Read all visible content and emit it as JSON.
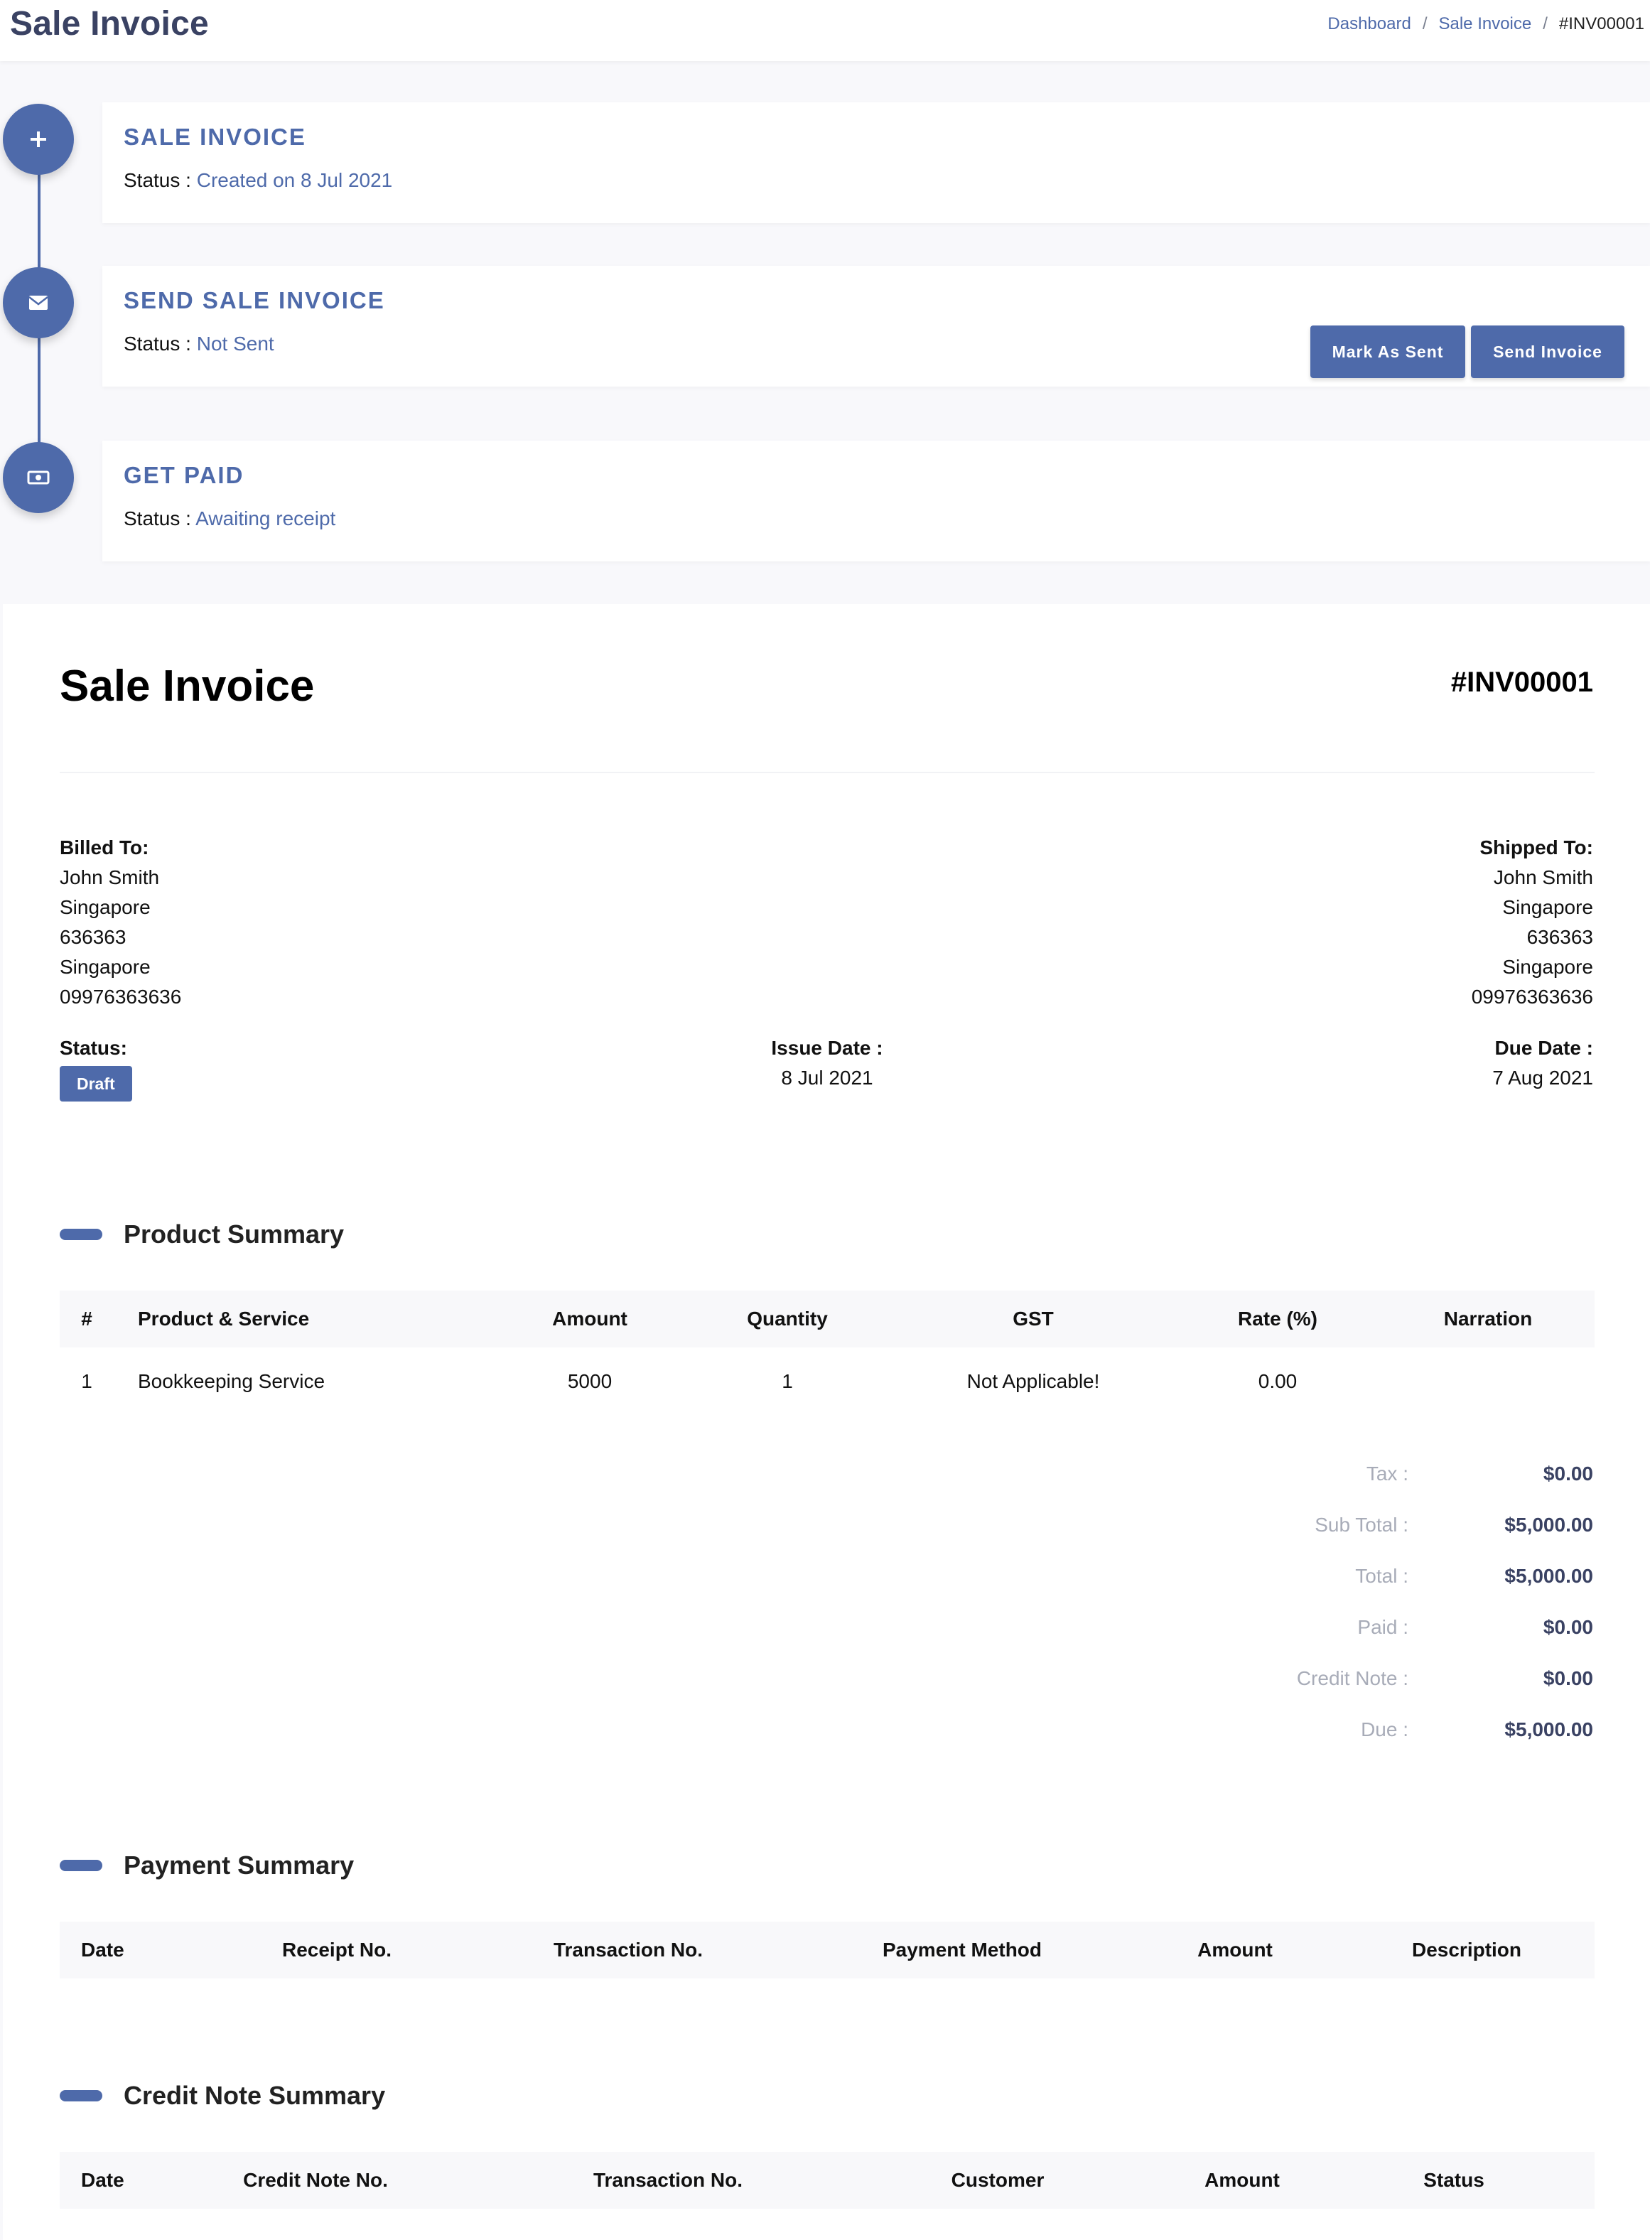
{
  "header": {
    "title": "Sale Invoice",
    "breadcrumb": [
      "Dashboard",
      "Sale Invoice",
      "#INV00001"
    ],
    "separator": "/"
  },
  "timeline": {
    "status_label": "Status :",
    "steps": [
      {
        "icon": "plus-icon",
        "title": "SALE INVOICE",
        "status": "Created on 8 Jul 2021"
      },
      {
        "icon": "envelope-icon",
        "title": "SEND SALE INVOICE",
        "status": "Not Sent"
      },
      {
        "icon": "money-icon",
        "title": "GET PAID",
        "status": "Awaiting receipt"
      }
    ],
    "buttons": {
      "mark_as_sent": "Mark As Sent",
      "send_invoice": "Send Invoice"
    }
  },
  "invoice": {
    "title": "Sale Invoice",
    "number": "#INV00001",
    "billed_to": {
      "label": "Billed To:",
      "lines": [
        "John Smith",
        "Singapore",
        "636363",
        "Singapore",
        "09976363636"
      ]
    },
    "shipped_to": {
      "label": "Shipped To:",
      "lines": [
        "John Smith",
        "Singapore",
        "636363",
        "Singapore",
        "09976363636"
      ]
    },
    "status": {
      "label": "Status:",
      "value": "Draft"
    },
    "issue_date": {
      "label": "Issue Date :",
      "value": "8 Jul 2021"
    },
    "due_date": {
      "label": "Due Date :",
      "value": "7 Aug 2021"
    }
  },
  "product_summary": {
    "title": "Product Summary",
    "columns": [
      "#",
      "Product & Service",
      "Amount",
      "Quantity",
      "GST",
      "Rate (%)",
      "Narration"
    ],
    "rows": [
      [
        "1",
        "Bookkeeping Service",
        "5000",
        "1",
        "Not Applicable!",
        "0.00",
        ""
      ]
    ]
  },
  "totals": [
    {
      "label": "Tax :",
      "value": "$0.00"
    },
    {
      "label": "Sub Total :",
      "value": "$5,000.00"
    },
    {
      "label": "Total :",
      "value": "$5,000.00"
    },
    {
      "label": "Paid :",
      "value": "$0.00"
    },
    {
      "label": "Credit Note :",
      "value": "$0.00"
    },
    {
      "label": "Due :",
      "value": "$5,000.00"
    }
  ],
  "payment_summary": {
    "title": "Payment Summary",
    "columns": [
      "Date",
      "Receipt No.",
      "Transaction No.",
      "Payment Method",
      "Amount",
      "Description"
    ]
  },
  "credit_note_summary": {
    "title": "Credit Note Summary",
    "columns": [
      "Date",
      "Credit Note No.",
      "Transaction No.",
      "Customer",
      "Amount",
      "Status"
    ]
  },
  "colors": {
    "accent": "#4e6aaa",
    "title": "#3a4263",
    "muted": "#a8acb8"
  }
}
